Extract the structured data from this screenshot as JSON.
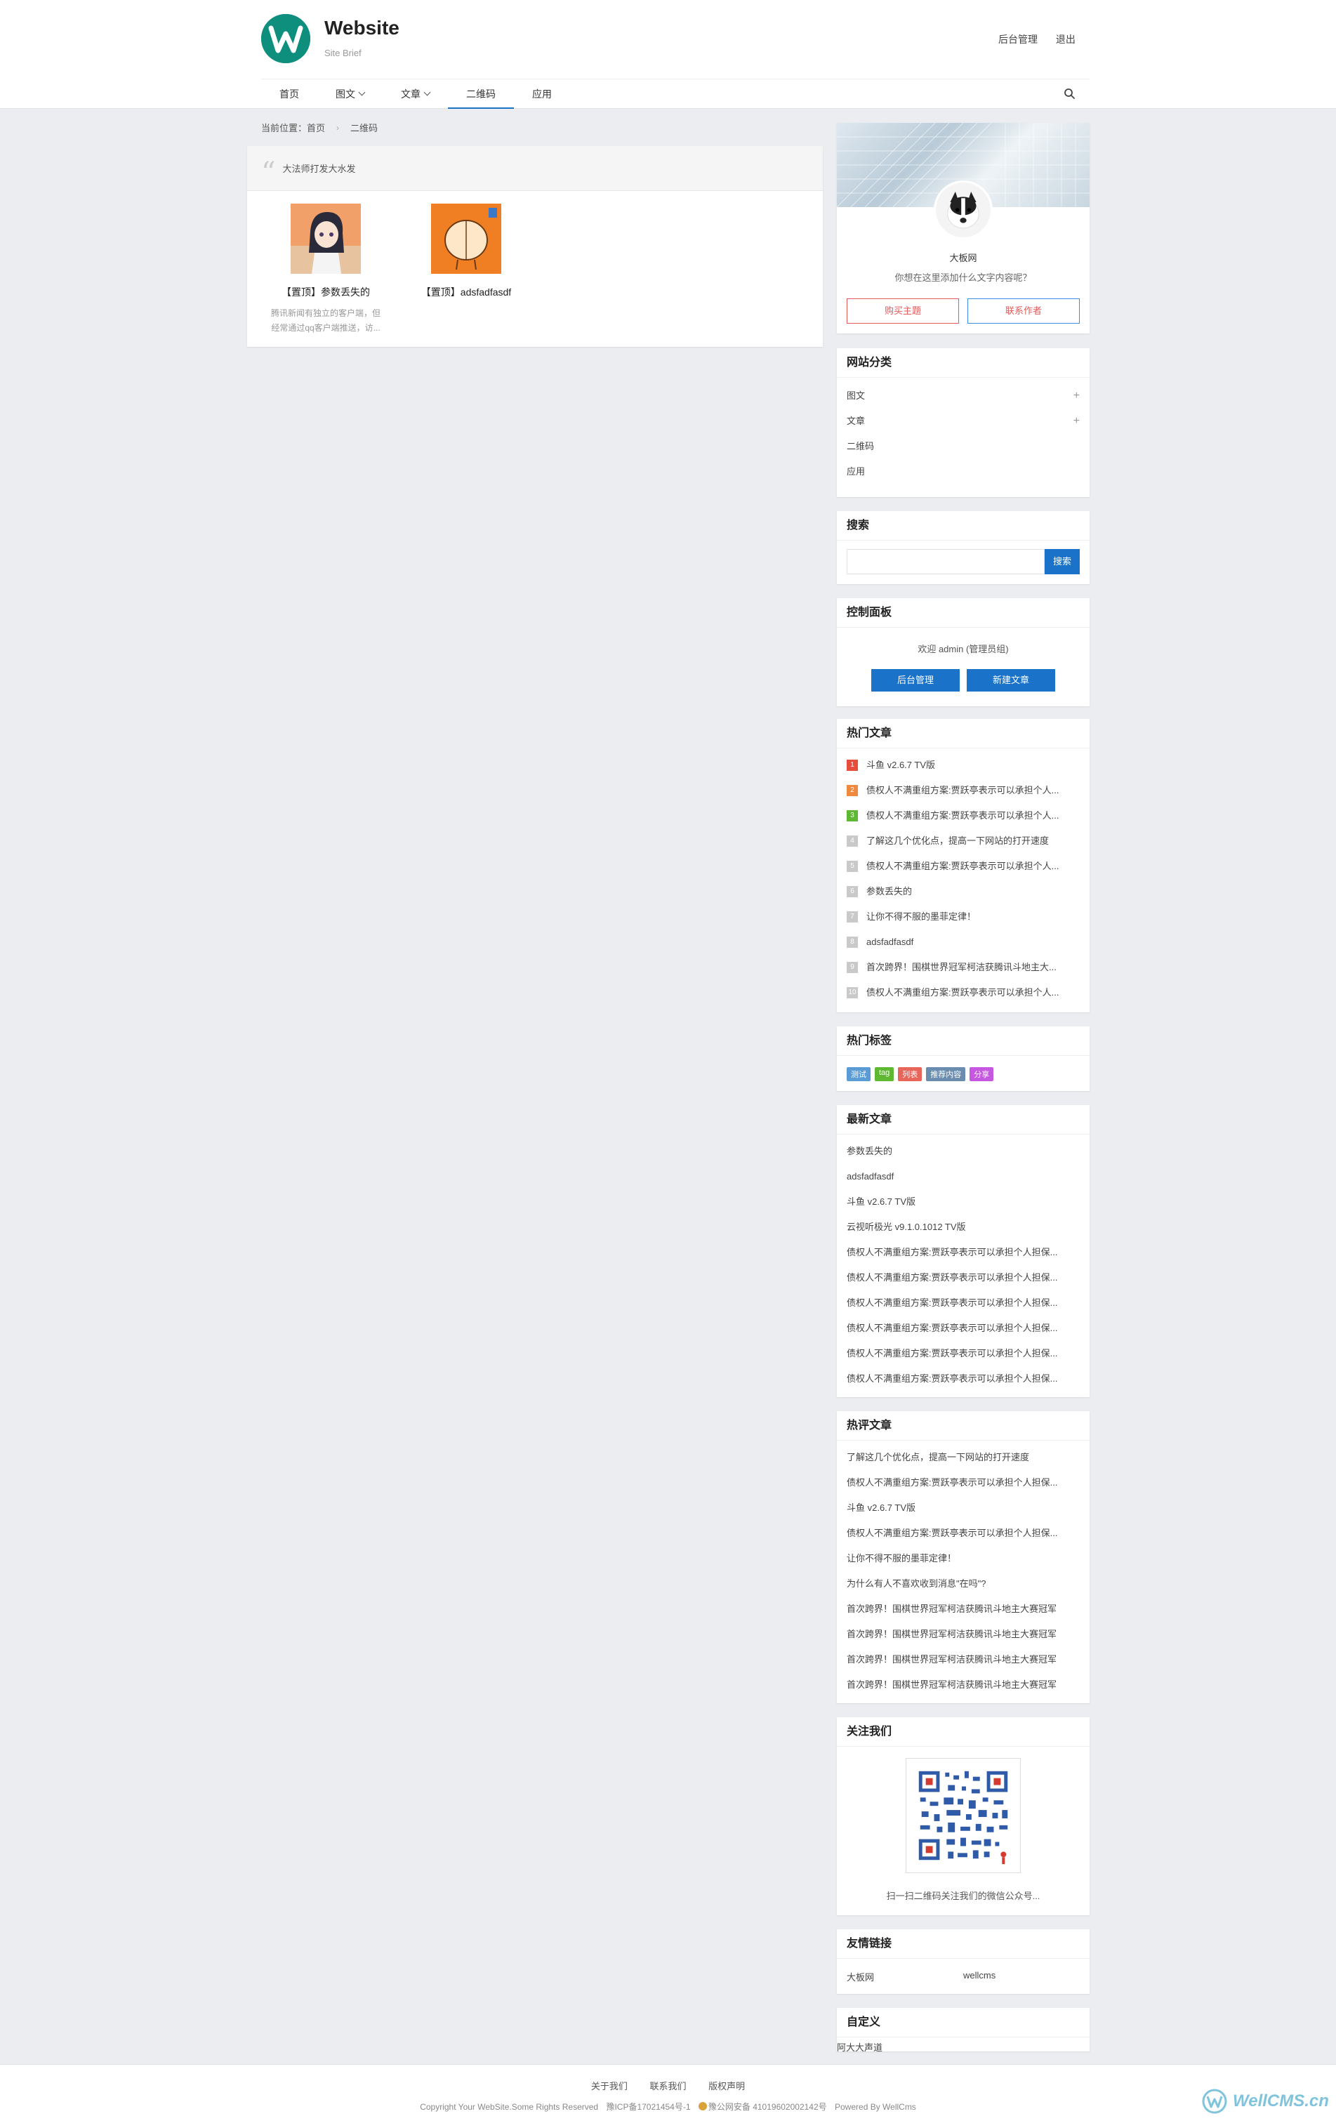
{
  "header": {
    "site_title": "Website",
    "site_brief": "Site Brief",
    "admin_link": "后台管理",
    "logout_link": "退出",
    "logo_letter": "W"
  },
  "nav": {
    "items": [
      {
        "label": "首页",
        "active": false,
        "dropdown": false
      },
      {
        "label": "图文",
        "active": false,
        "dropdown": true
      },
      {
        "label": "文章",
        "active": false,
        "dropdown": true
      },
      {
        "label": "二维码",
        "active": true,
        "dropdown": false
      },
      {
        "label": "应用",
        "active": false,
        "dropdown": false
      }
    ]
  },
  "breadcrumb": {
    "prefix": "当前位置：",
    "home": "首页",
    "separator": "›",
    "current": "二维码"
  },
  "main": {
    "notice": "大法师打发大水发",
    "items": [
      {
        "title": "【置顶】参数丢失的",
        "desc_line1": "腾讯新闻有独立的客户端，但",
        "desc_line2": "经常通过qq客户端推送，访..."
      },
      {
        "title": "【置顶】adsfadfasdf"
      }
    ]
  },
  "profile": {
    "name": "大板网",
    "signature": "你想在这里添加什么文字内容呢？",
    "buy_button": "购买主题",
    "contact_button": "联系作者"
  },
  "categories": {
    "title": "网站分类",
    "items": [
      {
        "label": "图文",
        "expandable": true
      },
      {
        "label": "文章",
        "expandable": true
      },
      {
        "label": "二维码",
        "expandable": false
      },
      {
        "label": "应用",
        "expandable": false
      }
    ]
  },
  "search": {
    "title": "搜索",
    "button": "搜索",
    "placeholder": ""
  },
  "control": {
    "title": "控制面板",
    "welcome": "欢迎 admin (管理员组)",
    "admin_button": "后台管理",
    "new_button": "新建文章"
  },
  "hot_articles": {
    "title": "热门文章",
    "items": [
      {
        "rank": "1",
        "title": "斗鱼 v2.6.7 TV版"
      },
      {
        "rank": "2",
        "title": "债权人不满重组方案:贾跃亭表示可以承担个人..."
      },
      {
        "rank": "3",
        "title": "债权人不满重组方案:贾跃亭表示可以承担个人..."
      },
      {
        "rank": "4",
        "title": "了解这几个优化点，提高一下网站的打开速度"
      },
      {
        "rank": "5",
        "title": "债权人不满重组方案:贾跃亭表示可以承担个人..."
      },
      {
        "rank": "6",
        "title": "参数丢失的"
      },
      {
        "rank": "7",
        "title": "让你不得不服的墨菲定律！"
      },
      {
        "rank": "8",
        "title": "adsfadfasdf"
      },
      {
        "rank": "9",
        "title": "首次跨界！围棋世界冠军柯洁获腾讯斗地主大..."
      },
      {
        "rank": "10",
        "title": "债权人不满重组方案:贾跃亭表示可以承担个人..."
      }
    ]
  },
  "hot_tags": {
    "title": "热门标签",
    "items": [
      {
        "label": "测试",
        "color": "#5b9bd5"
      },
      {
        "label": "tag",
        "color": "#5fb832"
      },
      {
        "label": "列表",
        "color": "#e8655a"
      },
      {
        "label": "推荐内容",
        "color": "#6a8caf"
      },
      {
        "label": "分享",
        "color": "#c557e0"
      }
    ]
  },
  "latest": {
    "title": "最新文章",
    "items": [
      "参数丢失的",
      "adsfadfasdf",
      "斗鱼 v2.6.7 TV版",
      "云视听极光 v9.1.0.1012 TV版",
      "债权人不满重组方案:贾跃亭表示可以承担个人担保...",
      "债权人不满重组方案:贾跃亭表示可以承担个人担保...",
      "债权人不满重组方案:贾跃亭表示可以承担个人担保...",
      "债权人不满重组方案:贾跃亭表示可以承担个人担保...",
      "债权人不满重组方案:贾跃亭表示可以承担个人担保...",
      "债权人不满重组方案:贾跃亭表示可以承担个人担保..."
    ]
  },
  "hot_comments": {
    "title": "热评文章",
    "items": [
      "了解这几个优化点，提高一下网站的打开速度",
      "债权人不满重组方案:贾跃亭表示可以承担个人担保...",
      "斗鱼 v2.6.7 TV版",
      "债权人不满重组方案:贾跃亭表示可以承担个人担保...",
      "让你不得不服的墨菲定律！",
      "为什么有人不喜欢收到消息\"在吗\"?",
      "首次跨界！围棋世界冠军柯洁获腾讯斗地主大赛冠军",
      "首次跨界！围棋世界冠军柯洁获腾讯斗地主大赛冠军",
      "首次跨界！围棋世界冠军柯洁获腾讯斗地主大赛冠军",
      "首次跨界！围棋世界冠军柯洁获腾讯斗地主大赛冠军"
    ]
  },
  "follow": {
    "title": "关注我们",
    "caption": "扫一扫二维码关注我们的微信公众号..."
  },
  "friend_links": {
    "title": "友情链接",
    "items": [
      "大板网",
      "wellcms"
    ]
  },
  "custom": {
    "title": "自定义",
    "body": "阿大大声道"
  },
  "footer": {
    "links": [
      "关于我们",
      "联系我们",
      "版权声明"
    ],
    "copyright": "Copyright Your WebSite.Some Rights Reserved",
    "icp": "豫ICP备17021454号-1",
    "police": "豫公网安备 41019602002142号",
    "powered": "Powered By WellCms",
    "watermark": "WellCMS.cn"
  }
}
